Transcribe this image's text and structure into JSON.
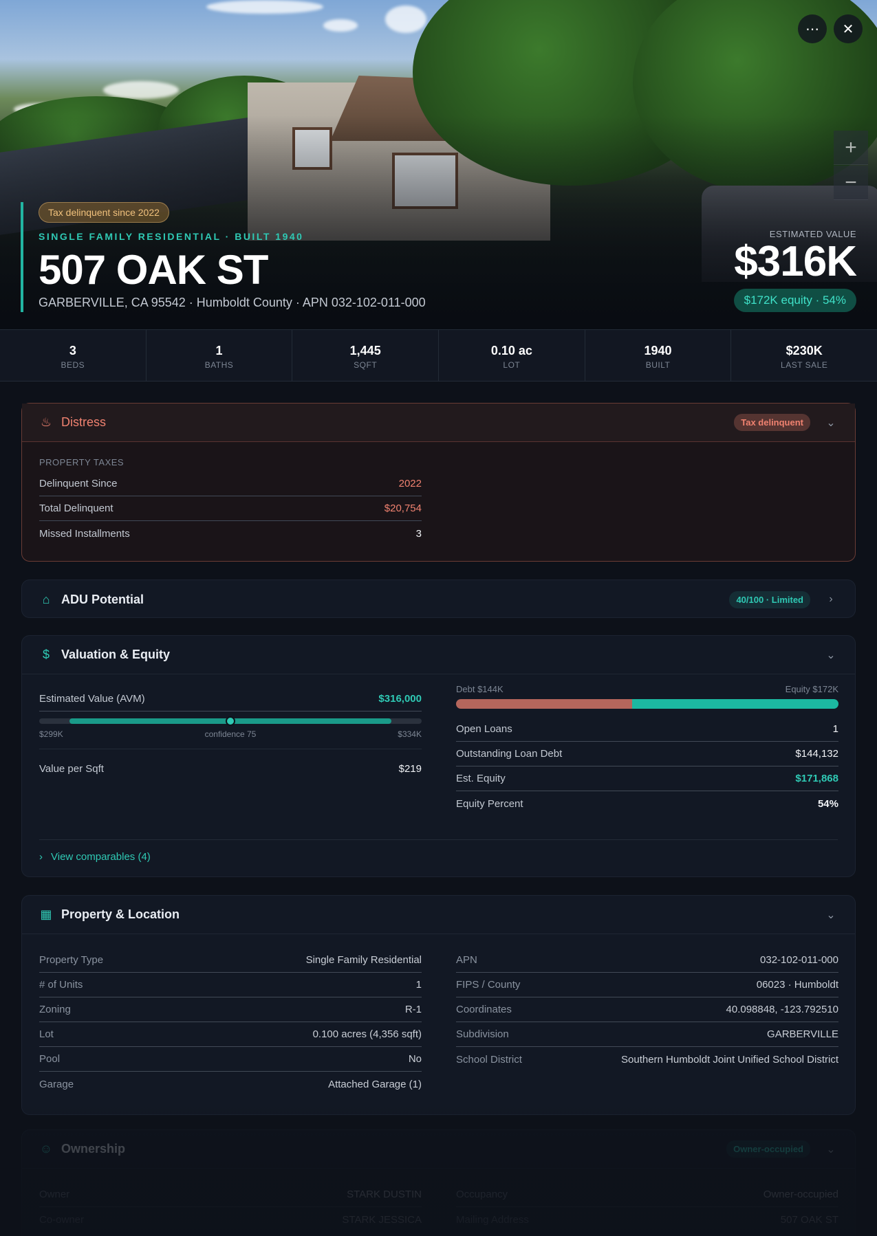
{
  "hero": {
    "tax_pill": "Tax delinquent since 2022",
    "subtitle": "SINGLE FAMILY RESIDENTIAL · BUILT 1940",
    "title": "507 OAK ST",
    "address": "GARBERVILLE, CA 95542 · Humboldt County · APN 032-102-011-000",
    "value_label": "ESTIMATED VALUE",
    "value": "$316K",
    "equity": "$172K equity · 54%",
    "more_icon": "more-horizontal-icon",
    "close_icon": "close-icon",
    "zoom_in": "+",
    "zoom_out": "−"
  },
  "stats": [
    {
      "value": "3",
      "label": "BEDS"
    },
    {
      "value": "1",
      "label": "BATHS"
    },
    {
      "value": "1,445",
      "label": "SQFT"
    },
    {
      "value": "0.10 ac",
      "label": "LOT"
    },
    {
      "value": "1940",
      "label": "BUILT"
    },
    {
      "value": "$230K",
      "label": "LAST SALE"
    }
  ],
  "distress": {
    "title": "Distress",
    "badge": "Tax delinquent",
    "section": "PROPERTY TAXES",
    "rows": [
      {
        "k": "Delinquent Since",
        "v": "2022"
      },
      {
        "k": "Total Delinquent",
        "v": "$20,754"
      },
      {
        "k": "Missed Installments",
        "v": "3"
      }
    ]
  },
  "adu": {
    "title": "ADU Potential",
    "badge": "40/100 · Limited"
  },
  "valuation": {
    "title": "Valuation & Equity",
    "avm_label": "Estimated Value (AVM)",
    "avm_value": "$316,000",
    "range_low": "$299K",
    "confidence": "confidence 75",
    "range_high": "$334K",
    "confidence_level": 0.5,
    "vps_label": "Value per Sqft",
    "vps_value": "$219",
    "debt_label": "Debt $144K",
    "equity_label": "Equity $172K",
    "debt_fraction": 0.46,
    "rows": [
      {
        "k": "Open Loans",
        "v": "1"
      },
      {
        "k": "Outstanding Loan Debt",
        "v": "$144,132"
      },
      {
        "k": "Est. Equity",
        "v": "$171,868"
      },
      {
        "k": "Equity Percent",
        "v": "54%"
      }
    ],
    "comparables": "View comparables (4)"
  },
  "property": {
    "title": "Property & Location",
    "left": [
      {
        "k": "Property Type",
        "v": "Single Family Residential"
      },
      {
        "k": "# of Units",
        "v": "1"
      },
      {
        "k": "Zoning",
        "v": "R-1"
      },
      {
        "k": "Lot",
        "v": "0.100 acres (4,356 sqft)"
      },
      {
        "k": "Pool",
        "v": "No"
      },
      {
        "k": "Garage",
        "v": "Attached Garage (1)"
      }
    ],
    "right": [
      {
        "k": "APN",
        "v": "032-102-011-000"
      },
      {
        "k": "FIPS / County",
        "v": "06023 · Humboldt"
      },
      {
        "k": "Coordinates",
        "v": "40.098848, -123.792510"
      },
      {
        "k": "Subdivision",
        "v": "GARBERVILLE"
      },
      {
        "k": "School District",
        "v": "Southern Humboldt Joint Unified School District"
      }
    ]
  },
  "ownership": {
    "title": "Ownership",
    "badge": "Owner-occupied",
    "left": [
      {
        "k": "Owner",
        "v": "STARK DUSTIN"
      },
      {
        "k": "Co-owner",
        "v": "STARK JESSICA"
      }
    ],
    "right": [
      {
        "k": "Occupancy",
        "v": "Owner-occupied"
      },
      {
        "k": "Mailing Address",
        "v": "507 OAK ST"
      }
    ]
  },
  "colors": {
    "accent": "#2fc9b4",
    "distress": "#f08270",
    "debt": "#b5665c",
    "equity": "#1cb8a1"
  }
}
